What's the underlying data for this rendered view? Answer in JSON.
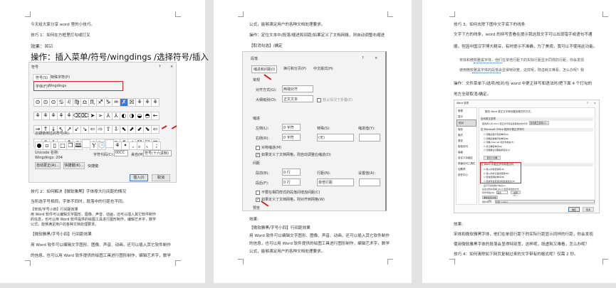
{
  "page1": {
    "lines": [
      "今天给大家分享 word 里的小技巧。",
      "技巧 1：如何在方框里打勾或打叉",
      "效果：☒☑"
    ],
    "operation": "操作：插入菜单/符号/wingdings /选择符号/插入",
    "symbol_dialog": {
      "title": "符号",
      "help": "?",
      "close": "×",
      "tabs": [
        "符号(S)",
        "特殊字符(P)"
      ],
      "font_label": "字体(F):",
      "font_value": "Wingdings",
      "grid": [
        "⊙⊙⊙♋♌♍♎♏♐♑♒✗☒⚘⚘⚘",
        "⚘⚘⚘⚘⚘⌫⌦➤➢⅄⅄◐◑◒◓←",
        "→↑↓↖↗↙↘⇦⇨⇧⇩⬉⬈⬋⬊⇦",
        "⇨⇧⇩⇔⇕⬀⬁⬃⬂▭▯✗✓☒☑⊞"
      ],
      "recent_label": "近期使用过的符号(R):",
      "recent": [
        "●",
        "▫",
        "▯",
        "□",
        "❐",
        "🕮",
        "",
        "Ⲩ",
        "🕑",
        "",
        "⚘",
        "•",
        ",",
        "。",
        "、",
        ";"
      ],
      "unicode_name_label": "Unicode 名称:",
      "char_name": "Wingdings: 204",
      "char_code_label": "字符代码(C):",
      "char_code": "00CC",
      "from_label": "来自(M):",
      "from_value": "符号(十六进制)",
      "autocorrect": "自动更正(A)...",
      "shortcut_btn": "快捷键(K)...",
      "shortcut_label": "快捷键:",
      "insert": "插入(I)",
      "cancel": "取消"
    },
    "tip2": "技巧 2：如何解决【微软雅黑】字体撑大行间距的情况",
    "p1": "当所选字号相同，字体不同时，段落中的行距也不同。",
    "songti_head": "【宋体/字号小四】行间距效果",
    "songti_body": [
      "用 Word 软件可以编辑文字图形、图像、声音、动画，还可以插入其它软件制作",
      "的信息，也可以用 Word 软件提供的绘图工具进行图形制作，编辑艺术字，数学",
      "公式，能够满足用户的各种文档处理要求。"
    ],
    "yahei_head": "【微软雅黑/字号小四】行间距效果",
    "yahei_body": [
      "用 Word 软件可以编辑文字图形、图像、声音、动画，还可以插入其它软件制作",
      "的信息，也可以用 Word 软件提供的绘图工具进行图形制作，编辑艺术字，数学"
    ]
  },
  "page2": {
    "lines": [
      "公式，能够满足用户的各种文档处理要求。",
      "操作：定位文本中/段落/缩进和间距/如果定义了文档网格，则自动调整右缩进",
      "【取消勾选】/确定"
    ],
    "para_dialog": {
      "title": "段落",
      "help": "?",
      "close": "×",
      "tabs": [
        "缩进和间距(I)",
        "换行和分页(P)",
        "中文版式(H)"
      ],
      "general": "常规",
      "align_label": "对齐方式(G):",
      "align_value": "两端对齐",
      "outline_label": "大纲级别(O):",
      "outline_value": "正文文本",
      "collapse": "默认情况下折叠(E)",
      "indent": "缩进",
      "left_label": "左侧(L):",
      "left_value": "0 字符",
      "right_label": "右侧(R):",
      "right_value": "0 字符",
      "special_label": "特殊(S):",
      "special_value": "(无)",
      "indent_by_label": "缩进值(Y):",
      "mirror": "对称缩进(M)",
      "auto_right": "如果定义了文档网格，则自动调整右缩进(D)",
      "spacing": "间距",
      "before_label": "段前(B):",
      "before_value": "0 行",
      "after_label": "段后(F):",
      "after_value": "0 行",
      "line_label": "行距(N):",
      "line_value": "单倍行距",
      "at_label": "设置值(A):",
      "no_space": "不要在相同样式的段落间增加间距(C)",
      "snap_grid": "如果定义了文档网格，则对齐到网格(W)",
      "preview": "预览"
    },
    "effect": "效果:",
    "yahei_head": "【微软雅黑/字号小四】行间距效果",
    "yahei_body": [
      "用 Word 软件可以编辑文字图形、图像、声音、动画，还可以插入其它软件制作",
      "的信息，也可以用 Word 软件提供的绘图工具进行图形制作，编辑艺术字，数学",
      "公式，能够满足用户的各种文档处理要求。"
    ]
  },
  "page3": {
    "lines": [
      "技巧 3、如何去除下图中文字底下的线条",
      "文字下方的线条，word 的拼写查看在提示我这段文字可以出现错字或语句不通",
      "顺，但因中国汉字博大精深，有时提示不准确，为了美观，我可以不使用此功能。"
    ],
    "sample": [
      "宋体和微软雅黑字体，他们在单倍行距下的实际行距显示同样的行距，你会发现",
      "使用微软雅黑字体的段落会显得特别宽，这样呢，既虚耗又难看，怎么办呢？我"
    ],
    "operation": [
      "操作：文件菜单下/选项/校对/在 word 中更正拼写和语法时/把下面 4 个打勾的",
      "地方全部取消/确定。"
    ],
    "options_dialog": {
      "title": "Word 选项",
      "help": "?",
      "close": "×",
      "nav": [
        "常规",
        "显示",
        "校对",
        "保存",
        "版式",
        "语言",
        "轻松访问",
        "高级",
        "自定义功能区",
        "快速访问工具栏",
        "加载项",
        "信任中心"
      ],
      "header": "更改 Word 更正文字和设置其格式的方式。",
      "sec1": "自动更正选项",
      "autocorrect_text": "更改键入时 Word 更正文字和设置其格式的方式:",
      "autocorrect_btn": "自动更正选项(A)...",
      "sec2": "在 Microsoft Office 程序中更正拼写时",
      "opts2": [
        "忽略全部大写的单词(U)",
        "忽略包含数字的单词(B)",
        "忽略 Internet 和文件地址(F)",
        "标记重复单词(R)",
        "仅根据主词典提供建议(I)"
      ],
      "dict_btn": "自定义词典(C)...",
      "sec3": "在 Word 中更正拼写和语法时",
      "opts3": [
        "键入时检查拼写(P)",
        "键入时标记语法错误(M)",
        "经常混淆的单词(N)",
        "随拼写检查语法和改进建议(H)"
      ],
      "extra": "显示可读性统计信息(L)",
      "style_text": "在此文档中选择 Word 检查语法的方式",
      "style_label": "写作风格(W):",
      "style_value": "语法",
      "settings_btn": "设置(T)...",
      "recheck_btn": "重新检查文档(K)",
      "exceptions_label": "例外项(X):",
      "exceptions_value": "文档 1.docx",
      "ok": "确定",
      "cancel": "取消"
    },
    "effect": "效果:",
    "body": [
      "宋体和微软雅黑字体，他们在单倍行距下的实际行距显示同样的行距，你会发现",
      "使用微软雅黑字体的段落会显得特别宽，这样呢，既虚耗又难看，怎么办呢？",
      "技巧 4：如何清除如下网页复制过来的文字带有的格式呢？仅需 2 秒。"
    ]
  },
  "colors": {
    "highlight_red": "#d22222",
    "selected_blue": "#3b78d8",
    "page_bg": "#ffffff",
    "workspace": "#e3e3e3"
  }
}
